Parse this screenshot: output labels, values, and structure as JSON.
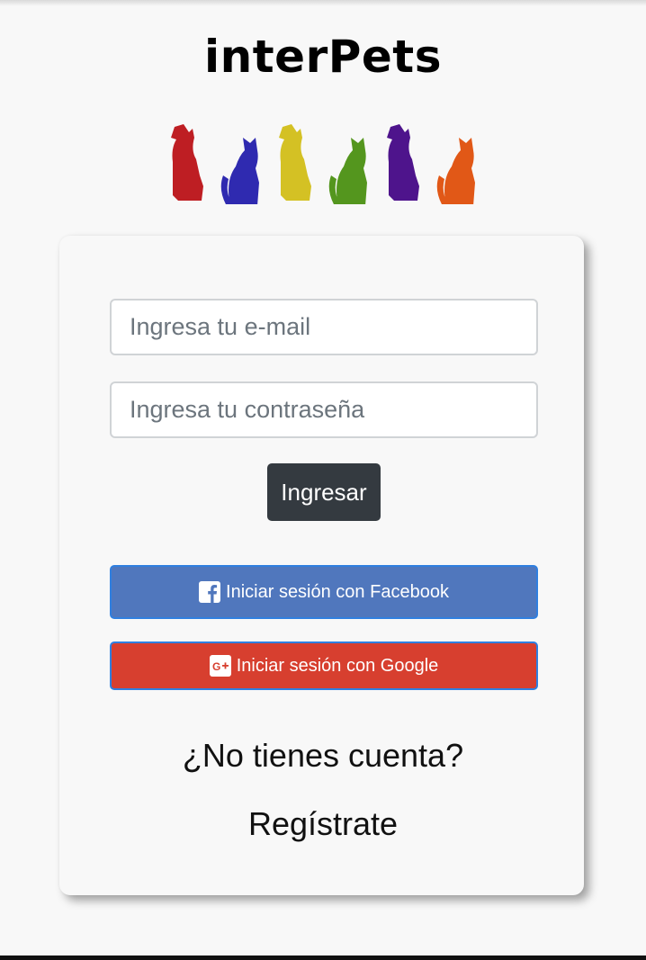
{
  "brand": {
    "title": "interPets"
  },
  "pets": {
    "colors": [
      "#be1e23",
      "#2f2ab0",
      "#d4c124",
      "#54961e",
      "#4e148c",
      "#e15817"
    ]
  },
  "login_form": {
    "email_placeholder": "Ingresa tu e-mail",
    "password_placeholder": "Ingresa tu contraseña",
    "submit_label": "Ingresar"
  },
  "social": {
    "facebook": {
      "label": "Iniciar sesión con Facebook",
      "color": "#5077bd",
      "icon": "facebook-icon"
    },
    "google": {
      "label": "Iniciar sesión con Google",
      "color": "#d73f2f",
      "icon": "google-plus-icon"
    }
  },
  "signup": {
    "question": "¿No tienes cuenta?",
    "link_label": "Regístrate"
  }
}
